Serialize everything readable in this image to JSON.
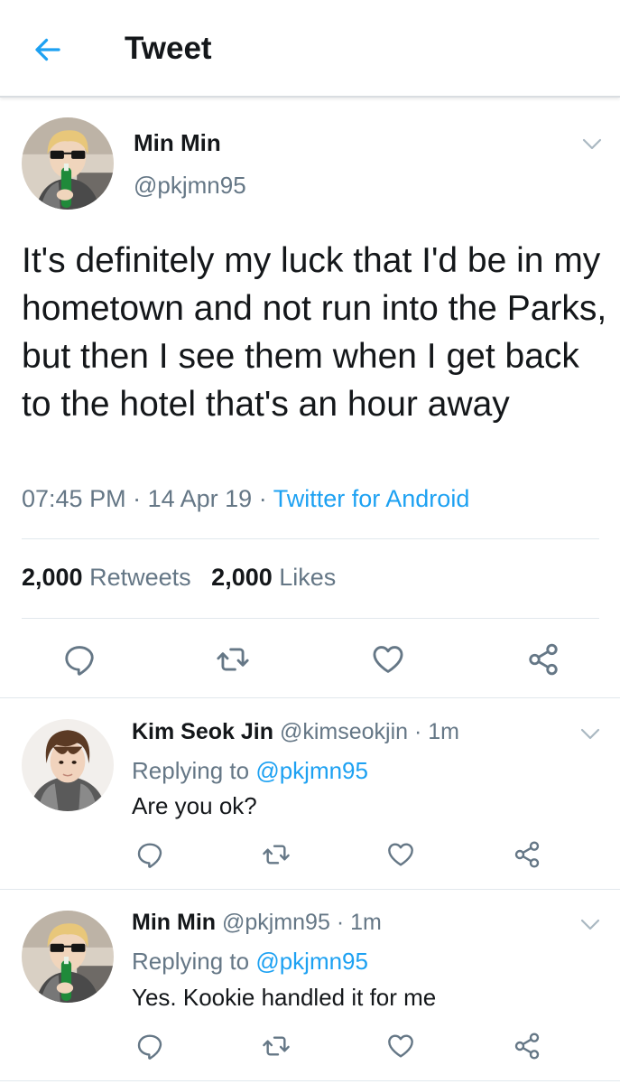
{
  "header": {
    "title": "Tweet",
    "accent": "#1da1f2"
  },
  "main_tweet": {
    "name": "Min Min",
    "handle": "@pkjmn95",
    "text": "It's definitely my luck that I'd be in my hometown and not run into the Parks, but then I see them when I get back to the hotel that's an hour away",
    "time": "07:45 PM",
    "date": "14 Apr 19",
    "separator": "·",
    "source": "Twitter for Android",
    "retweets_count": "2,000",
    "retweets_label": "Retweets",
    "likes_count": "2,000",
    "likes_label": "Likes"
  },
  "replies": [
    {
      "name": "Kim Seok Jin",
      "handle": "@kimseokjin",
      "age": "1m",
      "replying_label": "Replying to",
      "replying_to": "@pkjmn95",
      "text": "Are you ok?"
    },
    {
      "name": "Min Min",
      "handle": "@pkjmn95",
      "age": "1m",
      "replying_label": "Replying to",
      "replying_to": "@pkjmn95",
      "text": "Yes. Kookie handled it for me"
    }
  ],
  "icons": {
    "back": "arrow-left-icon",
    "more": "chevron-down-icon",
    "reply": "reply-icon",
    "retweet": "retweet-icon",
    "like": "heart-icon",
    "share": "share-icon"
  },
  "colors": {
    "text": "#14171a",
    "secondary": "#657786",
    "link": "#1da1f2",
    "icon": "#657786"
  }
}
